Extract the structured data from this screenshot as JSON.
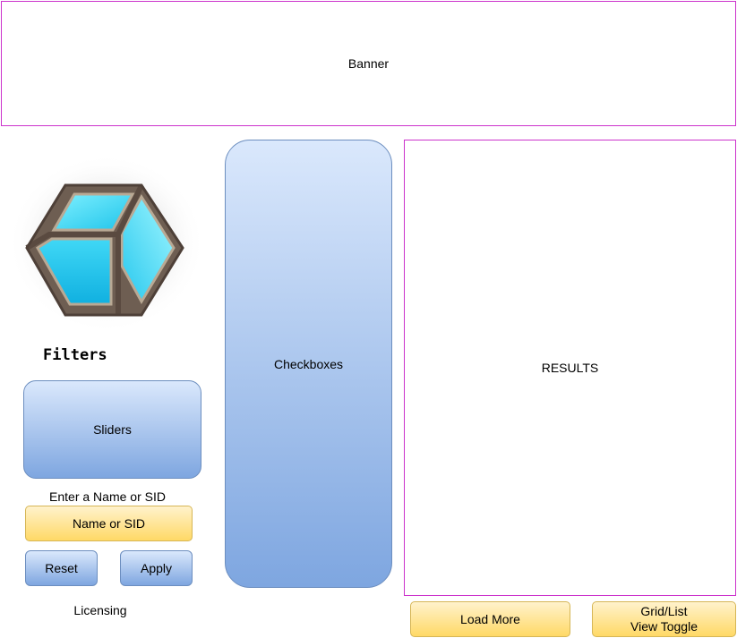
{
  "banner": {
    "label": "Banner"
  },
  "sidebar": {
    "logo_icon": "cube-logo",
    "filters_heading": "Filters",
    "sliders_label": "Sliders",
    "name_prompt": "Enter a Name or SID",
    "name_input_label": "Name or SID",
    "reset_label": "Reset",
    "apply_label": "Apply",
    "licensing_label": "Licensing"
  },
  "checkboxes": {
    "label": "Checkboxes"
  },
  "results": {
    "label": "RESULTS"
  },
  "footer": {
    "load_more_label": "Load More",
    "view_toggle_line1": "Grid/List",
    "view_toggle_line2": "View Toggle"
  },
  "colors": {
    "frame_border": "#cc33cc",
    "blue_top": "#dae8fc",
    "blue_bottom": "#7ea6e0",
    "blue_border": "#6c8ebf",
    "yellow_top": "#fff2cc",
    "yellow_bottom": "#ffd966",
    "yellow_border": "#d6b656"
  }
}
